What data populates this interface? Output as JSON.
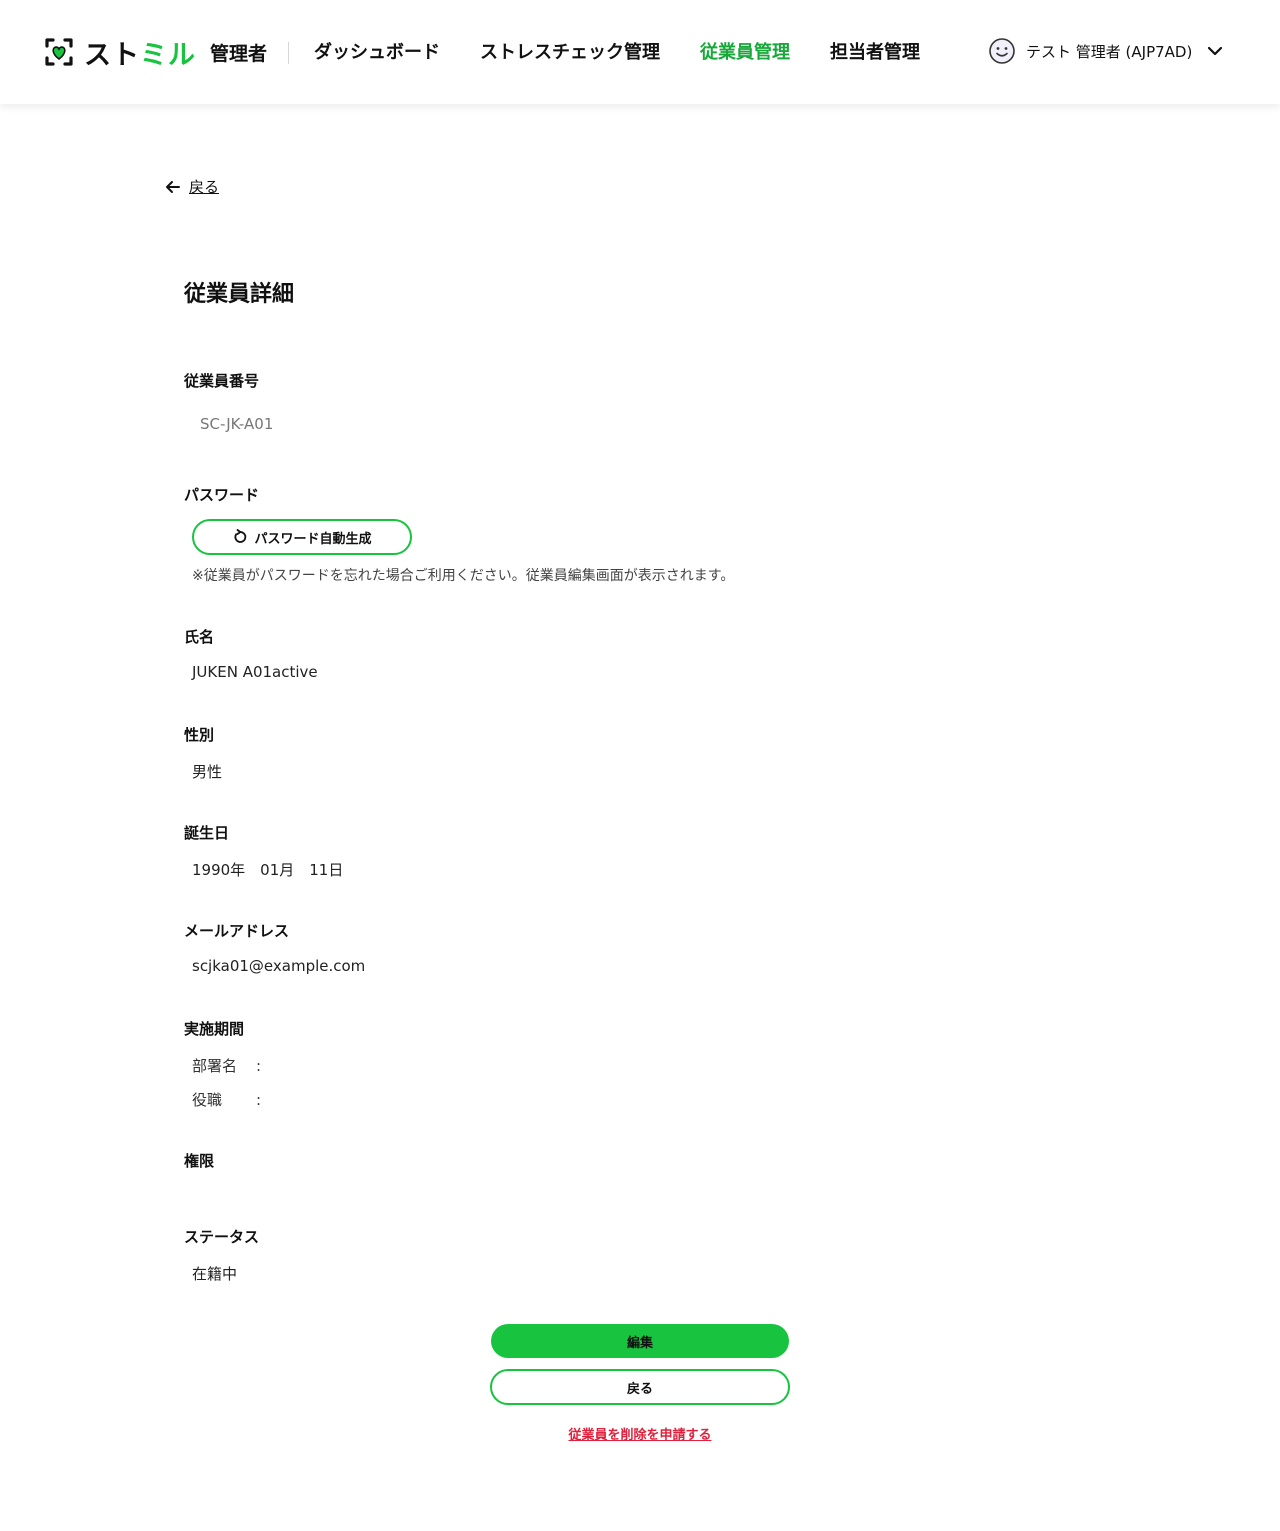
{
  "header": {
    "logo_text_prefix": "スト",
    "logo_text_accent": "ミル",
    "logo_role": "管理者",
    "brand_color": "#18c43f",
    "nav": [
      {
        "label": "ダッシュボード",
        "active": false
      },
      {
        "label": "ストレスチェック管理",
        "active": false
      },
      {
        "label": "従業員管理",
        "active": true
      },
      {
        "label": "担当者管理",
        "active": false
      }
    ],
    "user": {
      "name": "テスト 管理者 (AJP7AD)",
      "avatar_icon": "smiley-face-icon",
      "menu_icon": "chevron-down-icon"
    }
  },
  "back_link": {
    "label": "戻る",
    "icon": "arrow-left-icon"
  },
  "page_title": "従業員詳細",
  "fields": {
    "employee_number": {
      "label": "従業員番号",
      "value": "SC-JK-A01"
    },
    "password": {
      "label": "パスワード",
      "button_label": "パスワード自動生成",
      "button_icon": "refresh-icon",
      "note": "※従業員がパスワードを忘れた場合ご利用ください。従業員編集画面が表示されます。"
    },
    "name": {
      "label": "氏名",
      "value": "JUKEN A01active"
    },
    "gender": {
      "label": "性別",
      "value": "男性"
    },
    "birthday": {
      "label": "誕生日",
      "value": "1990年　01月　11日"
    },
    "email": {
      "label": "メールアドレス",
      "value": "scjka01@example.com"
    },
    "period": {
      "label": "実施期間",
      "department_label": "部署名",
      "department_value": "",
      "position_label": "役職",
      "position_value": "",
      "separator": ":"
    },
    "permission": {
      "label": "権限",
      "value": ""
    },
    "status": {
      "label": "ステータス",
      "value": "在籍中"
    }
  },
  "actions": {
    "edit_label": "編集",
    "back_label": "戻る",
    "delete_label": "従業員を削除を申請する",
    "delete_color": "#e0203c"
  }
}
